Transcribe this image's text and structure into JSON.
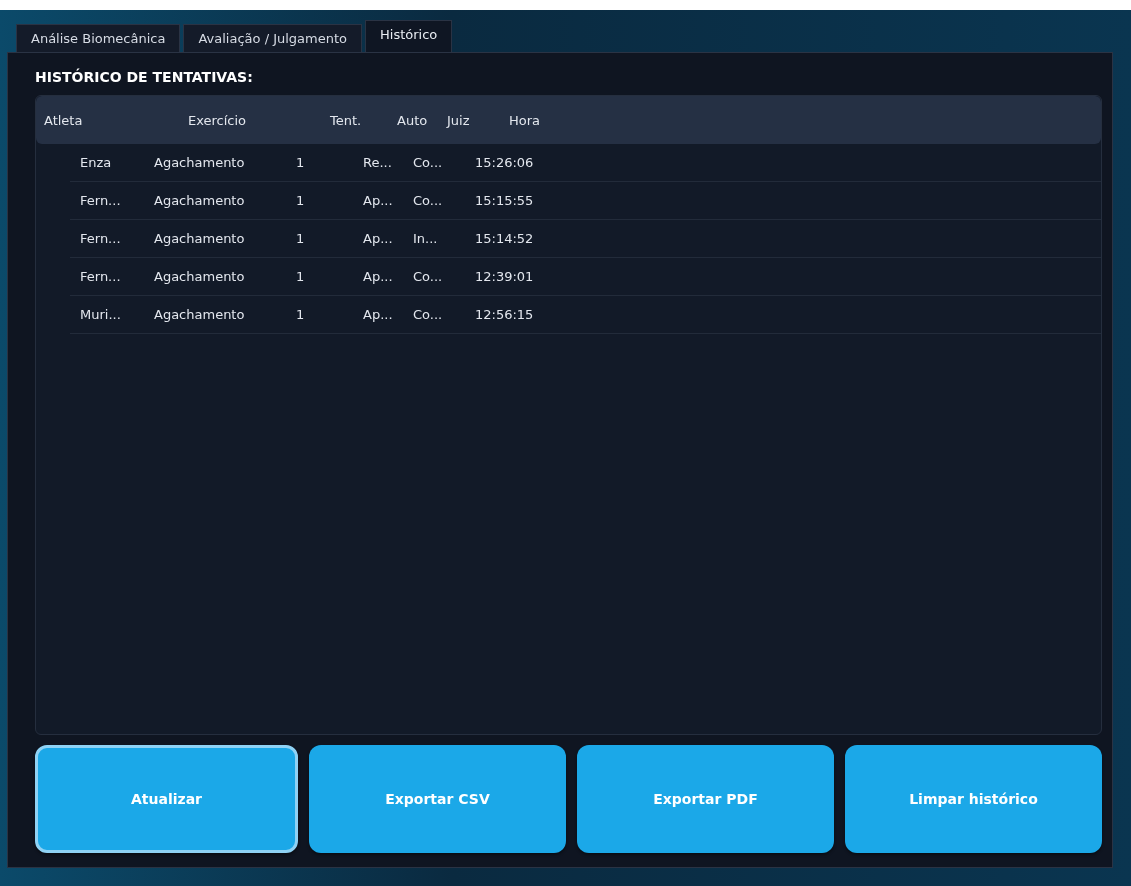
{
  "tabs": [
    {
      "label": "Análise Biomecânica",
      "selected": false
    },
    {
      "label": "Avaliação / Julgamento",
      "selected": false
    },
    {
      "label": "Histórico",
      "selected": true
    }
  ],
  "heading": "HISTÓRICO DE TENTATIVAS:",
  "table": {
    "columns": [
      "Atleta",
      "Exercício",
      "Tent.",
      "Auto",
      "Juiz",
      "Hora"
    ],
    "rows": [
      [
        "Enza",
        "Agachamento",
        "1",
        "Re...",
        "Co...",
        "15:26:06"
      ],
      [
        "Fern...",
        "Agachamento",
        "1",
        "Ap...",
        "Co...",
        "15:15:55"
      ],
      [
        "Fern...",
        "Agachamento",
        "1",
        "Ap...",
        "In...",
        "15:14:52"
      ],
      [
        "Fern...",
        "Agachamento",
        "1",
        "Ap...",
        "Co...",
        "12:39:01"
      ],
      [
        "Muri...",
        "Agachamento",
        "1",
        "Ap...",
        "Co...",
        "12:56:15"
      ]
    ]
  },
  "buttons": [
    {
      "label": "Atualizar",
      "focused": true
    },
    {
      "label": "Exportar CSV",
      "focused": false
    },
    {
      "label": "Exportar PDF",
      "focused": false
    },
    {
      "label": "Limpar histórico",
      "focused": false
    }
  ]
}
